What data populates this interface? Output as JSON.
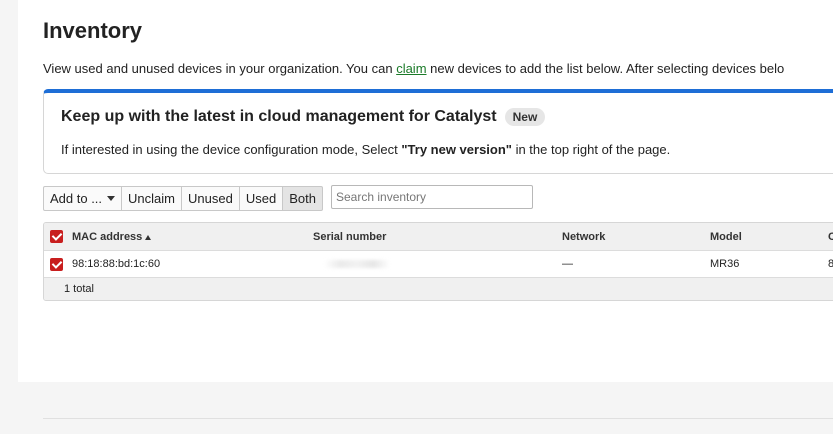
{
  "page": {
    "title": "Inventory",
    "intro_before": "View used and unused devices in your organization. You can ",
    "intro_link": "claim",
    "intro_after": " new devices to add the list below. After selecting devices belo"
  },
  "banner": {
    "title": "Keep up with the latest in cloud management for Catalyst",
    "badge": "New",
    "text_before": "If interested in using the device configuration mode, Select ",
    "text_bold": "\"Try new version\"",
    "text_after": " in the top right of the page."
  },
  "toolbar": {
    "add_to": "Add to ...",
    "unclaim": "Unclaim",
    "unused": "Unused",
    "used": "Used",
    "both": "Both",
    "active": "Both"
  },
  "search": {
    "placeholder": "Search inventory",
    "value": ""
  },
  "table": {
    "columns": {
      "mac": "MAC address",
      "serial": "Serial number",
      "network": "Network",
      "model": "Model",
      "extra": "C"
    },
    "rows": [
      {
        "mac": "98:18:88:bd:1c:60",
        "serial": "",
        "network": "—",
        "model": "MR36",
        "extra": "8"
      }
    ],
    "footer": "1 total"
  },
  "colors": {
    "accent_blue": "#1e6ed6",
    "checkbox_red": "#c81e1e",
    "link_green": "#1a7a28"
  }
}
